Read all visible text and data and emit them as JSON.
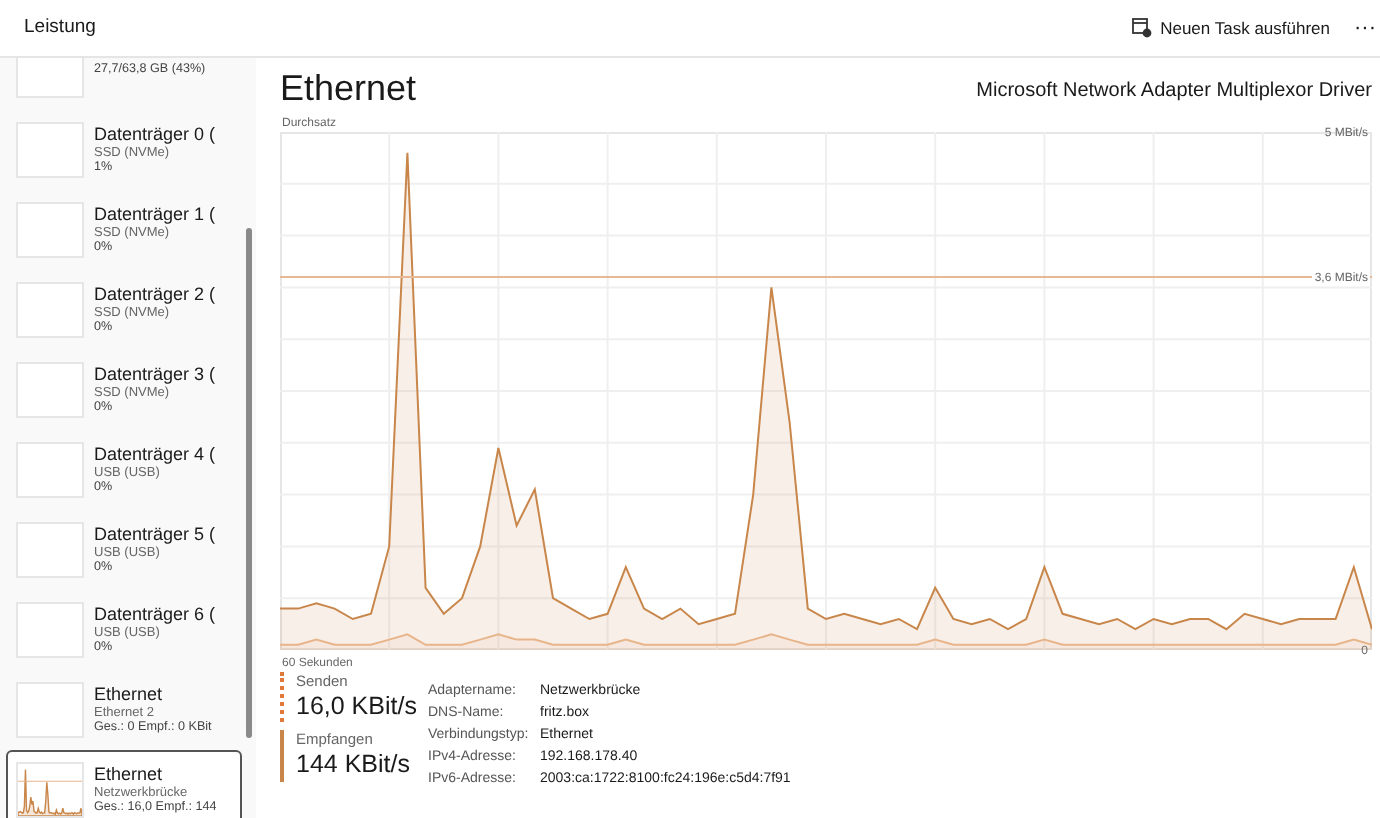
{
  "header": {
    "title": "Leistung",
    "action": "Neuen Task ausführen",
    "more": "···"
  },
  "sidebar": {
    "items": [
      {
        "value": "27,7/63,8 GB (43%)",
        "selected": false
      },
      {
        "name": "Datenträger 0 (",
        "subtitle": "SSD (NVMe)",
        "value": "1%",
        "selected": false
      },
      {
        "name": "Datenträger 1 (",
        "subtitle": "SSD (NVMe)",
        "value": "0%",
        "selected": false
      },
      {
        "name": "Datenträger 2 (",
        "subtitle": "SSD (NVMe)",
        "value": "0%",
        "selected": false
      },
      {
        "name": "Datenträger 3 (",
        "subtitle": "SSD (NVMe)",
        "value": "0%",
        "selected": false
      },
      {
        "name": "Datenträger 4 (",
        "subtitle": "USB (USB)",
        "value": "0%",
        "selected": false
      },
      {
        "name": "Datenträger 5 (",
        "subtitle": "USB (USB)",
        "value": "0%",
        "selected": false
      },
      {
        "name": "Datenträger 6 (",
        "subtitle": "USB (USB)",
        "value": "0%",
        "selected": false
      },
      {
        "name": "Ethernet",
        "subtitle": "Ethernet 2",
        "value": "Ges.: 0 Empf.: 0 KBit",
        "selected": false
      },
      {
        "name": "Ethernet",
        "subtitle": "Netzwerkbrücke",
        "value": "Ges.: 16,0 Empf.: 144",
        "selected": true
      }
    ]
  },
  "main": {
    "title": "Ethernet",
    "device": "Microsoft Network Adapter Multiplexor Driver",
    "chart_data": {
      "type": "area",
      "ylabel": "Durchsatz",
      "categories": [
        null,
        null,
        null,
        null,
        null,
        null,
        null,
        null,
        null,
        null,
        null,
        null,
        null,
        null,
        null,
        null,
        null,
        null,
        null,
        null,
        null,
        null,
        null,
        null,
        null,
        null,
        null,
        null,
        null,
        null,
        null,
        null,
        null,
        null,
        null,
        null,
        null,
        null,
        null,
        null,
        null,
        null,
        null,
        null,
        null,
        null,
        null,
        null,
        null,
        null,
        null,
        null,
        null,
        null,
        null,
        null,
        null,
        null,
        null,
        null,
        null
      ],
      "ylim": [
        0,
        5
      ],
      "xlabel": "60 Sekunden",
      "yticks": [
        {
          "value": 5,
          "label": "5 MBit/s"
        },
        {
          "value": 3.6,
          "label": "3,6 MBit/s"
        },
        {
          "value": 0,
          "label": "0"
        }
      ],
      "grid": true,
      "ref_lines": [
        {
          "axis": "y",
          "value": 3.6
        }
      ],
      "series": [
        {
          "name": "Empfangen",
          "color": "#c8864a",
          "values": [
            0.4,
            0.4,
            0.45,
            0.4,
            0.3,
            0.35,
            1.0,
            4.8,
            0.6,
            0.35,
            0.5,
            1.0,
            1.95,
            1.2,
            1.55,
            0.5,
            0.4,
            0.3,
            0.35,
            0.8,
            0.4,
            0.3,
            0.4,
            0.25,
            0.3,
            0.35,
            1.5,
            3.5,
            2.2,
            0.4,
            0.3,
            0.35,
            0.3,
            0.25,
            0.3,
            0.2,
            0.6,
            0.3,
            0.25,
            0.3,
            0.2,
            0.3,
            0.8,
            0.35,
            0.3,
            0.25,
            0.3,
            0.2,
            0.3,
            0.25,
            0.3,
            0.3,
            0.2,
            0.35,
            0.3,
            0.25,
            0.3,
            0.3,
            0.3,
            0.8,
            0.2
          ]
        },
        {
          "name": "Senden",
          "color": "#e8b48a",
          "values": [
            0.05,
            0.05,
            0.1,
            0.05,
            0.05,
            0.05,
            0.1,
            0.15,
            0.05,
            0.05,
            0.05,
            0.1,
            0.15,
            0.1,
            0.1,
            0.05,
            0.05,
            0.05,
            0.05,
            0.1,
            0.05,
            0.05,
            0.05,
            0.05,
            0.05,
            0.05,
            0.1,
            0.15,
            0.1,
            0.05,
            0.05,
            0.05,
            0.05,
            0.05,
            0.05,
            0.05,
            0.1,
            0.05,
            0.05,
            0.05,
            0.05,
            0.05,
            0.1,
            0.05,
            0.05,
            0.05,
            0.05,
            0.05,
            0.05,
            0.05,
            0.05,
            0.05,
            0.05,
            0.05,
            0.05,
            0.05,
            0.05,
            0.05,
            0.05,
            0.1,
            0.05
          ]
        }
      ]
    },
    "rates": [
      {
        "value": "16,0 KBit/s",
        "kind": "send"
      },
      {
        "value": "144 KBit/s",
        "kind": "receive"
      }
    ],
    "properties": [
      {
        "label": "Adaptername:",
        "value": "Netzwerkbrücke"
      },
      {
        "label": "DNS-Name:",
        "value": "fritz.box"
      },
      {
        "label": "Verbindungstyp:",
        "value": "Ethernet"
      },
      {
        "label": "IPv4-Adresse:",
        "value": "192.168.178.40"
      },
      {
        "label": "IPv6-Adresse:",
        "value": "2003:ca:1722:8100:fc24:196e:c5d4:7f91"
      }
    ]
  }
}
